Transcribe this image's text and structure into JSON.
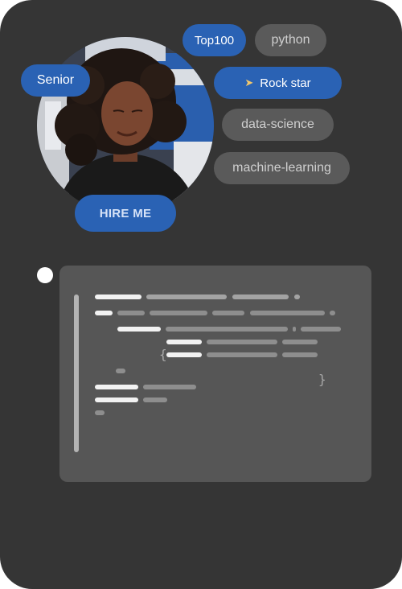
{
  "profile": {
    "photo_alt": "profile-photo",
    "hire_button_label": "HIRE ME"
  },
  "tags": {
    "senior": "Senior",
    "top100": "Top100",
    "python": "python",
    "rock_star": "Rock star",
    "rock_star_icon": "rocket-icon",
    "data_science": "data-science",
    "machine_learning": "machine-learning"
  },
  "code_preview": {
    "open_brace": "{",
    "close_brace": "}"
  },
  "colors": {
    "card_background": "#353535",
    "accent_blue": "#2a62b4",
    "tag_grey": "#5a5a5a",
    "code_panel": "#565656"
  }
}
